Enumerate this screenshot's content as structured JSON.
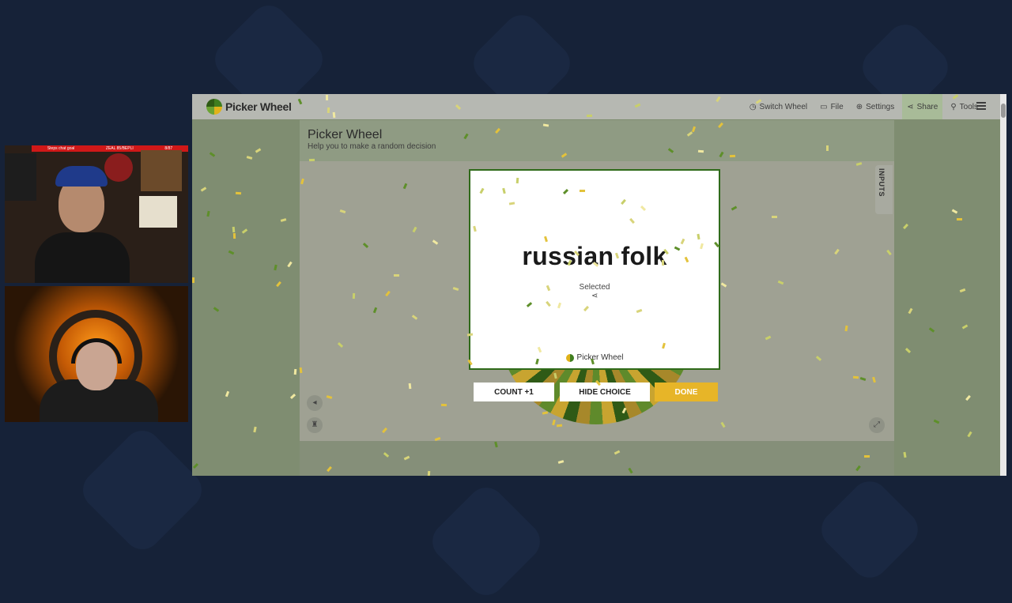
{
  "app": {
    "logo_text": "Picker Wheel",
    "nav": [
      {
        "label": "Switch Wheel",
        "icon": "clock-icon"
      },
      {
        "label": "File",
        "icon": "folder-icon"
      },
      {
        "label": "Settings",
        "icon": "globe-icon"
      },
      {
        "label": "Share",
        "icon": "share-icon"
      },
      {
        "label": "Tools",
        "icon": "wrench-icon"
      }
    ],
    "active_nav": "Share",
    "menu_icon": "hamburger-icon"
  },
  "page": {
    "title": "Picker Wheel",
    "subtitle": "Help you to make a random decision"
  },
  "side_tab": {
    "label": "INPUTS"
  },
  "result_modal": {
    "result_text": "russian folk",
    "status_text": "Selected",
    "brand_text": "Picker Wheel"
  },
  "actions": {
    "count_label": "COUNT +1",
    "hide_label": "HIDE CHOICE",
    "done_label": "DONE"
  },
  "colors": {
    "brand_green": "#2f6a1a",
    "done_yellow": "#e7b528",
    "overlay": "#7f8d71",
    "background": "#162238"
  },
  "stream_overlay": {
    "banner_left": "Steps chat goal",
    "banner_mid": "ZEAL 85/BEPLI",
    "banner_right": "8/87"
  }
}
